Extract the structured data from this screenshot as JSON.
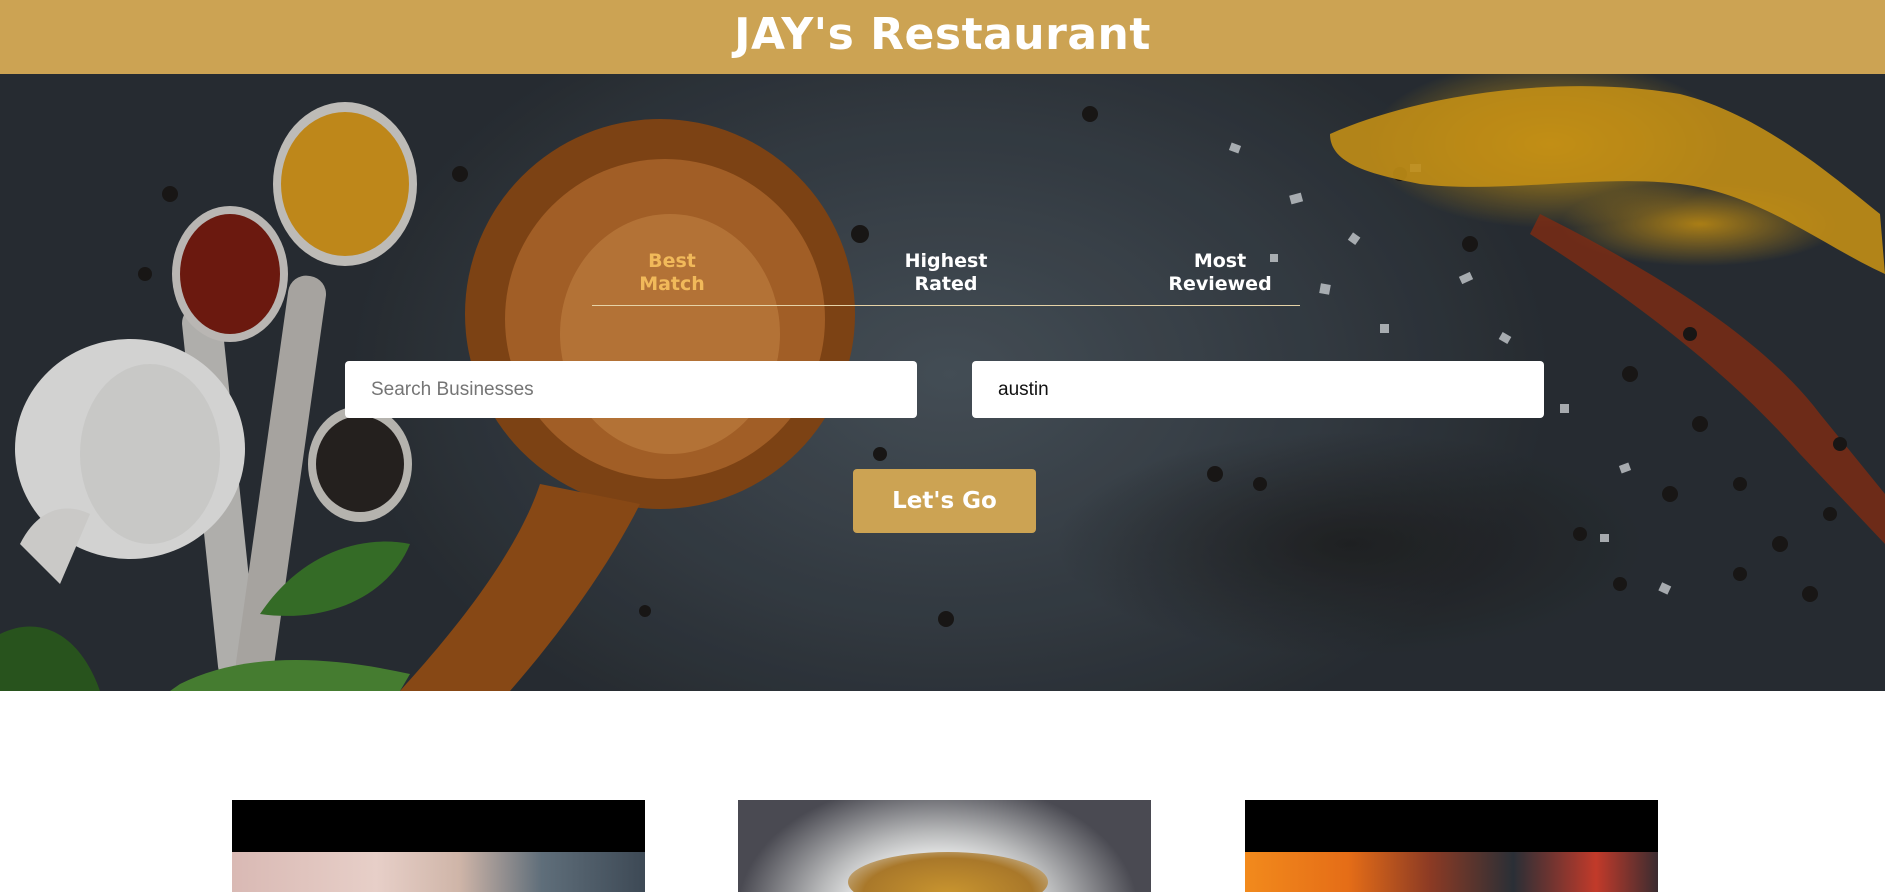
{
  "header": {
    "title": "JAY's Restaurant"
  },
  "sort": {
    "options": [
      {
        "label_line1": "Best",
        "label_line2": "Match",
        "active": true
      },
      {
        "label_line1": "Highest",
        "label_line2": "Rated",
        "active": false
      },
      {
        "label_line1": "Most",
        "label_line2": "Reviewed",
        "active": false
      }
    ]
  },
  "search": {
    "business_placeholder": "Search Businesses",
    "business_value": "",
    "location_value": "austin",
    "submit_label": "Let's Go"
  },
  "colors": {
    "brand": "#cca353",
    "active_tab": "#f1b95a"
  }
}
